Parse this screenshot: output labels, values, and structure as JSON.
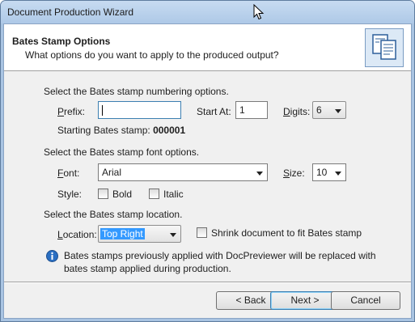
{
  "window": {
    "title": "Document Production Wizard"
  },
  "header": {
    "title": "Bates Stamp Options",
    "subtitle": "What options do you want to apply to the produced output?",
    "icon": "documents-icon"
  },
  "numbering": {
    "section_label": "Select the Bates stamp numbering options.",
    "prefix_label_accel": "P",
    "prefix_label_rest": "refix:",
    "prefix_value": "",
    "start_label": "Start At:",
    "start_value": "1",
    "digits_label_accel": "D",
    "digits_label_rest": "igits:",
    "digits_value": "6",
    "starting_label": "Starting Bates stamp:",
    "starting_value": "000001"
  },
  "font": {
    "section_label": "Select the Bates stamp font options.",
    "font_label_accel": "F",
    "font_label_rest": "ont:",
    "font_value": "Arial",
    "size_label_accel": "S",
    "size_label_rest": "ize:",
    "size_value": "10",
    "style_label": "Style:",
    "bold_label": "Bold",
    "bold_checked": false,
    "italic_label": "Italic",
    "italic_checked": false
  },
  "location": {
    "section_label": "Select the Bates stamp location.",
    "location_label_accel": "L",
    "location_label_rest": "ocation:",
    "location_value": "Top Right",
    "shrink_label": "Shrink document to fit Bates stamp",
    "shrink_checked": false
  },
  "info": {
    "icon": "info-icon",
    "text": "Bates stamps previously applied with DocPreviewer will be replaced with bates stamp applied during production."
  },
  "buttons": {
    "back": "< Back",
    "next": "Next >",
    "cancel": "Cancel"
  },
  "colors": {
    "frame": "#a9c4e2",
    "accent": "#3399ff",
    "info_icon": "#2b6fc2"
  }
}
